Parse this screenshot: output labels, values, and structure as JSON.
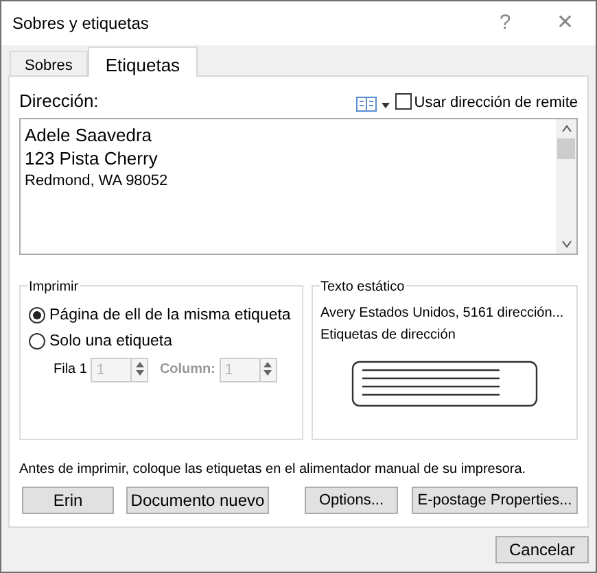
{
  "window": {
    "title": "Sobres y etiquetas",
    "help": "?",
    "close": "✕"
  },
  "tabs": [
    {
      "label": "Sobres",
      "selected": false
    },
    {
      "label": "Etiquetas",
      "selected": true
    }
  ],
  "address": {
    "label": "Dirección:",
    "lines": [
      "Adele Saavedra",
      "123 Pista Cherry",
      "Redmond, WA 98052"
    ],
    "use_return_address": {
      "label": "Usar dirección de remite",
      "checked": false
    }
  },
  "print": {
    "title": "Imprimir",
    "options": [
      {
        "label": "Página de ell de la misma etiqueta",
        "selected": true
      },
      {
        "label": "Solo una etiqueta",
        "selected": false
      }
    ],
    "row": {
      "label": "Fila 1",
      "value": "1",
      "disabled": true
    },
    "column": {
      "label": "Column:",
      "value": "1",
      "disabled": true
    }
  },
  "label_info": {
    "title": "Texto estático",
    "lines": [
      "Avery Estados Unidos, 5161 dirección...",
      "Etiquetas de dirección"
    ]
  },
  "note": "Antes de imprimir, coloque las etiquetas en el alimentador manual de su impresora.",
  "buttons": [
    "Erin",
    "Documento nuevo",
    "Options...",
    "E-postage Properties..."
  ],
  "footer_buttons": [
    "Cancelar"
  ]
}
